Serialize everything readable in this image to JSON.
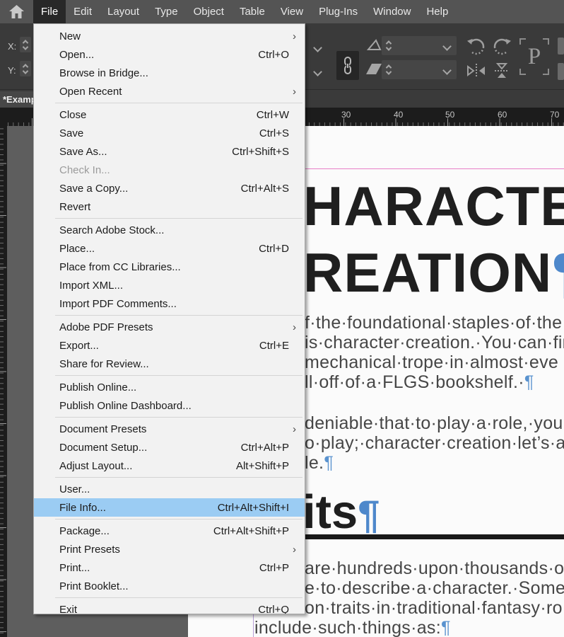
{
  "menubar": {
    "items": [
      {
        "label": "File",
        "active": true
      },
      {
        "label": "Edit"
      },
      {
        "label": "Layout"
      },
      {
        "label": "Type"
      },
      {
        "label": "Object"
      },
      {
        "label": "Table"
      },
      {
        "label": "View"
      },
      {
        "label": "Plug-Ins"
      },
      {
        "label": "Window"
      },
      {
        "label": "Help"
      }
    ]
  },
  "control_panel": {
    "x_label": "X:",
    "y_label": "Y:",
    "proxy_letter": "P",
    "icons": [
      "stepper",
      "link-chain",
      "shear",
      "skew",
      "rotate-cw",
      "rotate-ccw",
      "flip-horizontal",
      "flip-vertical",
      "reference-point-proxy"
    ]
  },
  "tabbar": {
    "document_tab": "*Examp"
  },
  "ruler": {
    "h_numbers": [
      {
        "label": "30"
      },
      {
        "label": "40"
      },
      {
        "label": "50"
      },
      {
        "label": "60"
      },
      {
        "label": "70"
      }
    ]
  },
  "file_menu": {
    "items": [
      {
        "label": "New",
        "submenu": true
      },
      {
        "label": "Open...",
        "shortcut": "Ctrl+O"
      },
      {
        "label": "Browse in Bridge..."
      },
      {
        "label": "Open Recent",
        "submenu": true
      },
      {
        "separator": true
      },
      {
        "label": "Close",
        "shortcut": "Ctrl+W"
      },
      {
        "label": "Save",
        "shortcut": "Ctrl+S"
      },
      {
        "label": "Save As...",
        "shortcut": "Ctrl+Shift+S"
      },
      {
        "label": "Check In...",
        "disabled": true
      },
      {
        "label": "Save a Copy...",
        "shortcut": "Ctrl+Alt+S"
      },
      {
        "label": "Revert"
      },
      {
        "separator": true
      },
      {
        "label": "Search Adobe Stock..."
      },
      {
        "label": "Place...",
        "shortcut": "Ctrl+D"
      },
      {
        "label": "Place from CC Libraries..."
      },
      {
        "label": "Import XML..."
      },
      {
        "label": "Import PDF Comments..."
      },
      {
        "separator": true
      },
      {
        "label": "Adobe PDF Presets",
        "submenu": true
      },
      {
        "label": "Export...",
        "shortcut": "Ctrl+E"
      },
      {
        "label": "Share for Review..."
      },
      {
        "separator": true
      },
      {
        "label": "Publish Online..."
      },
      {
        "label": "Publish Online Dashboard..."
      },
      {
        "separator": true
      },
      {
        "label": "Document Presets",
        "submenu": true
      },
      {
        "label": "Document Setup...",
        "shortcut": "Ctrl+Alt+P"
      },
      {
        "label": "Adjust Layout...",
        "shortcut": "Alt+Shift+P"
      },
      {
        "separator": true
      },
      {
        "label": "User..."
      },
      {
        "label": "File Info...",
        "shortcut": "Ctrl+Alt+Shift+I",
        "highlighted": true
      },
      {
        "separator": true
      },
      {
        "label": "Package...",
        "shortcut": "Ctrl+Alt+Shift+P"
      },
      {
        "label": "Print Presets",
        "submenu": true
      },
      {
        "label": "Print...",
        "shortcut": "Ctrl+P"
      },
      {
        "label": "Print Booklet..."
      },
      {
        "separator": true
      },
      {
        "label": "Exit",
        "shortcut": "Ctrl+Q"
      }
    ]
  },
  "document": {
    "heading_line1": "HARACTE",
    "heading_line2": "REATION",
    "subheading": "its",
    "pilcrow": "¶",
    "para1_lines": [
      "f·the·foundational·staples·of·the",
      "is·character·creation.·You·can·fin",
      "mechanical·trope·in·almost·eve",
      "ll·off·of·a·FLGS·bookshelf.·"
    ],
    "para2_lines": [
      "deniable·that·to·play·a·role,·you",
      "o·play;·character·creation·let’s·a",
      "le."
    ],
    "para3_lines": [
      "are·hundreds·upon·thousands·o",
      "e·to·describe·a·character.·Some",
      "on·traits·in·traditional·fantasy·ro"
    ],
    "para3_last": "include·such·things·as:"
  },
  "colors": {
    "menu_highlight": "#9bccf3",
    "guide_magenta": "#e87fc6",
    "guide_violet": "#b79fd8",
    "pilcrow_blue": "#4e88cb",
    "panel_dark": "#3a3a3a",
    "menubar_gray": "#545454"
  },
  "symbols": {
    "submenu_arrow": "›"
  }
}
